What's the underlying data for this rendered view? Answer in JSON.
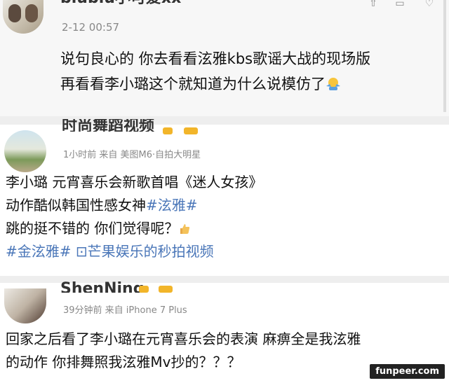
{
  "posts": [
    {
      "username": "biubiu小可爱xx",
      "meta": "2-12 00:57",
      "lines": [
        "说句良心的 你去看看泫雅kbs歌谣大战的现场版",
        "再看看李小璐这个就知道为什么说模仿了"
      ],
      "emoji": "shrug-emoji"
    },
    {
      "username": "时尚舞蹈视频",
      "meta": "1小时前  来自 美图M6·自拍大明星",
      "lines": [
        "李小璐 元宵喜乐会新歌首唱《迷人女孩》",
        "动作酷似韩国性感女神",
        "跳的挺不错的 你们觉得呢？"
      ],
      "hashtag": "#泫雅#",
      "hashtag2": "#金泫雅#",
      "video_link": "芒果娱乐的秒拍视频",
      "emoji": "thumbs-up-emoji"
    },
    {
      "username": "ShenNing",
      "meta": "39分钟前  来自 iPhone 7 Plus",
      "lines": [
        "回家之后看了李小璐在元宵喜乐会的表演 麻痹全是我泫雅",
        "的动作 你排舞照我泫雅Mv抄的？？？"
      ]
    }
  ],
  "watermark": "funpeer.com",
  "colors": {
    "link": "#4a76b8",
    "badge": "#f2b52a"
  }
}
